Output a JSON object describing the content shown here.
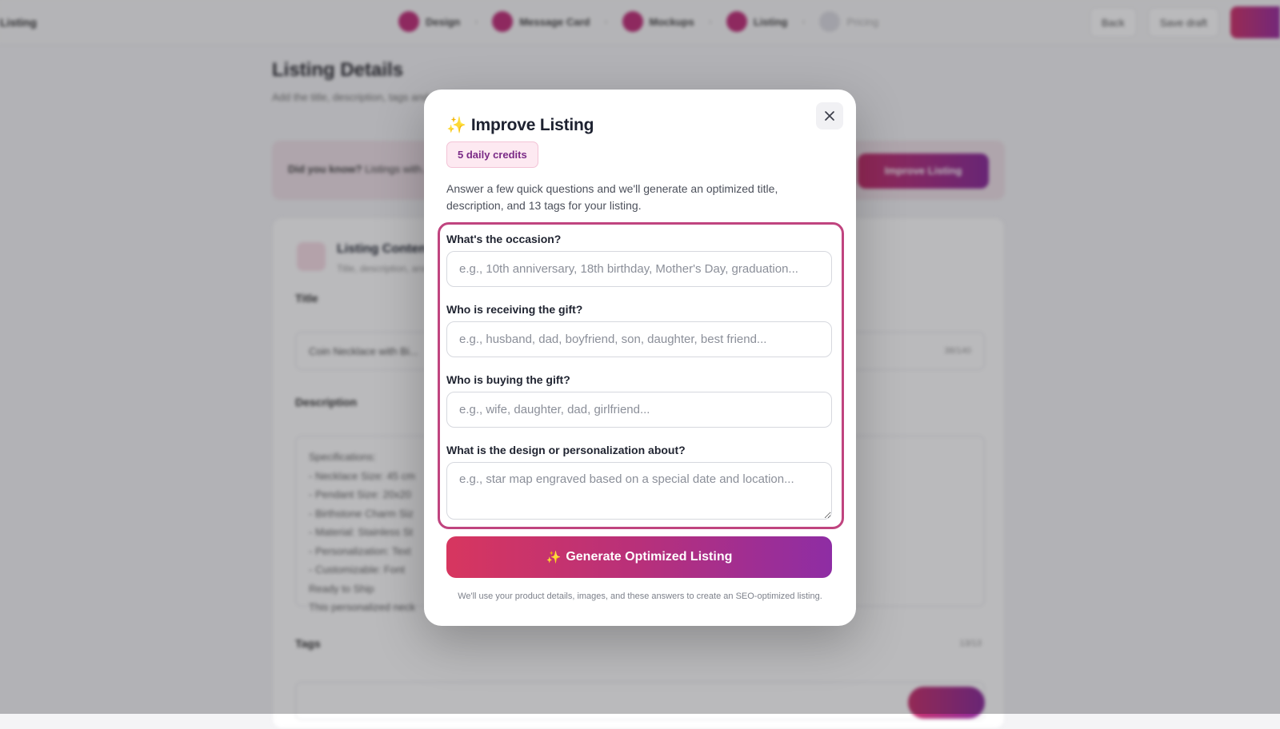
{
  "background": {
    "brand": "Listing",
    "steps": [
      {
        "label": "Design"
      },
      {
        "label": "Message Card"
      },
      {
        "label": "Mockups"
      },
      {
        "label": "Listing"
      },
      {
        "label": "Pricing"
      }
    ],
    "actions": {
      "back": "Back",
      "save_draft": "Save draft"
    },
    "page_title": "Listing Details",
    "page_subtitle": "Add the title, description, tags and optimize it for more visibility.",
    "tip": {
      "lead": "Did you know?",
      "text": "Listings with...",
      "button": "Improve Listing"
    },
    "card": {
      "title": "Listing Content",
      "subtitle": "Title, description, and tags",
      "title_label": "Title",
      "title_value": "Coin Necklace with Bi...",
      "title_count": "38/140",
      "description_label": "Description",
      "description_lines": [
        "Specifications:",
        "- Necklace Size: 45 cm",
        "- Pendant Size: 20x20",
        "- Birthstone Charm Siz",
        "- Material: Stainless St",
        "- Personalization: Text",
        "- Customizable: Font",
        "Ready to Ship",
        "This personalized neck"
      ],
      "tags_label": "Tags",
      "tags_count": "13/13"
    }
  },
  "modal": {
    "title": "Improve Listing",
    "credits": "5 daily credits",
    "description": "Answer a few quick questions and we'll generate an optimized title, description, and 13 tags for your listing.",
    "questions": [
      {
        "label": "What's the occasion?",
        "placeholder": "e.g., 10th anniversary, 18th birthday, Mother's Day, graduation..."
      },
      {
        "label": "Who is receiving the gift?",
        "placeholder": "e.g., husband, dad, boyfriend, son, daughter, best friend..."
      },
      {
        "label": "Who is buying the gift?",
        "placeholder": "e.g., wife, daughter, dad, girlfriend..."
      },
      {
        "label": "What is the design or personalization about?",
        "placeholder": "e.g., star map engraved based on a special date and location..."
      }
    ],
    "generate_button": "Generate Optimized Listing",
    "footnote": "We'll use your product details, images, and these answers to create an SEO-optimized listing."
  },
  "icons": {
    "sparkle": "sparkles-icon",
    "close": "close-icon"
  },
  "colors": {
    "accent_start": "#d7365f",
    "accent_end": "#8e2da4",
    "frame": "#c0447f",
    "badge_bg": "#fde9f1",
    "badge_text": "#7a2a86"
  }
}
